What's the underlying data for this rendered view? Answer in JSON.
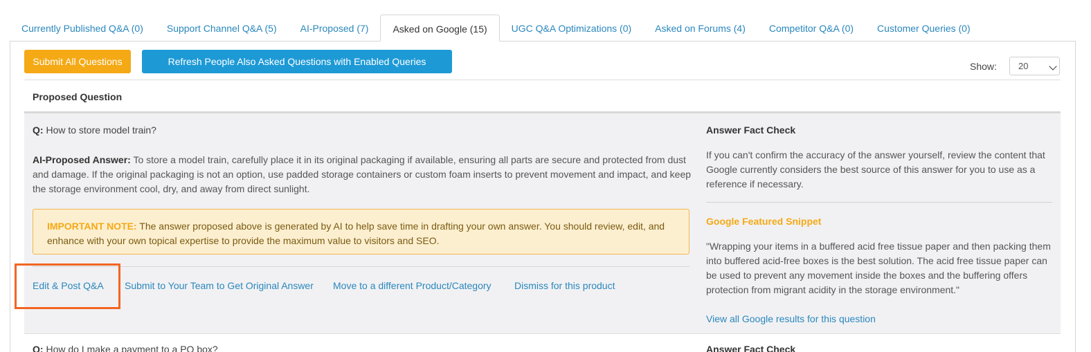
{
  "tabs": [
    {
      "label": "Currently Published Q&A (0)"
    },
    {
      "label": "Support Channel Q&A (5)"
    },
    {
      "label": "AI-Proposed (7)"
    },
    {
      "label": "Asked on Google (15)"
    },
    {
      "label": "UGC Q&A Optimizations (0)"
    },
    {
      "label": "Asked on Forums (4)"
    },
    {
      "label": "Competitor Q&A (0)"
    },
    {
      "label": "Customer Queries (0)"
    }
  ],
  "toolbar": {
    "submit_all_label": "Submit All Questions",
    "refresh_label": "Refresh People Also Asked Questions with Enabled Queries",
    "show_label": "Show:",
    "show_value": "20"
  },
  "table": {
    "header": "Proposed Question"
  },
  "row1": {
    "q_label": "Q:",
    "question": "How to store model train?",
    "answer_label": "AI-Proposed Answer:",
    "answer": "To store a model train, carefully place it in its original packaging if available, ensuring all parts are secure and protected from dust and damage. If the original packaging is not an option, use padded storage containers or custom foam inserts to prevent movement and impact, and keep the storage environment cool, dry, and away from direct sunlight.",
    "note_label": "IMPORTANT NOTE:",
    "note_text": "The answer proposed above is generated by AI to help save time in drafting your own answer. You should review, edit, and enhance with your own topical expertise to provide the maximum value to visitors and SEO.",
    "actions": {
      "edit_post": "Edit & Post Q&A",
      "submit_team": "Submit to Your Team to Get Original Answer",
      "move": "Move to a different Product/Category",
      "dismiss": "Dismiss for this product"
    },
    "fact_check_title": "Answer Fact Check",
    "fact_check_text": "If you can't confirm the accuracy of the answer yourself, review the content that Google currently considers the best source of this answer for you to use as a reference if necessary.",
    "snippet_title": "Google Featured Snippet",
    "snippet_text": "\"Wrapping your items in a buffered acid free tissue paper and then packing them into buffered acid-free boxes is the best solution. The acid free tissue paper can be used to prevent any movement inside the boxes and the buffering offers protection from migrant acidity in the storage environment.\"",
    "view_all": "View all Google results for this question"
  },
  "row2": {
    "q_label": "Q:",
    "question": "How do I make a payment to a PO box?",
    "fact_check_title": "Answer Fact Check"
  },
  "colors": {
    "accent_orange": "#f5a915",
    "accent_blue": "#1d9ad6",
    "link": "#2a87bd",
    "highlight": "#f26522"
  }
}
